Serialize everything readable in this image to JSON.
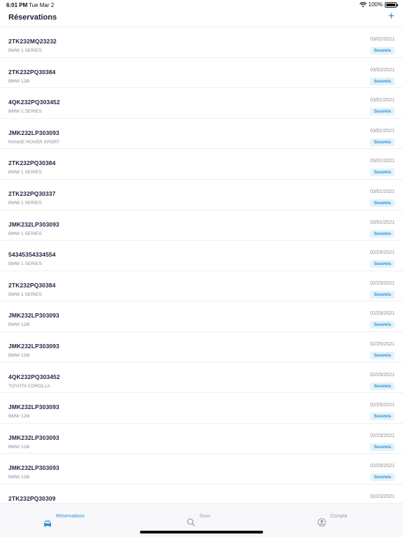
{
  "status_bar": {
    "time": "6:01 PM",
    "date": "Tue Mar 2",
    "battery": "100%",
    "battery_level": 1.0
  },
  "nav": {
    "title": "Réservations",
    "add_label": "+"
  },
  "reservations": [
    {
      "plate": "2TK232MQ23232",
      "model": "BMW 1 SERIES",
      "date": "03/02/2021",
      "status": "Soumis"
    },
    {
      "plate": "2TK232PQ30384",
      "model": "BMW 128i",
      "date": "03/02/2021",
      "status": "Soumis"
    },
    {
      "plate": "4QK232PQ303452",
      "model": "BMW 1 SERIES",
      "date": "03/01/2021",
      "status": "Soumis"
    },
    {
      "plate": "JMK232LP303093",
      "model": "RANGE ROVER SPORT",
      "date": "03/01/2021",
      "status": "Soumis"
    },
    {
      "plate": "2TK232PQ30384",
      "model": "BMW 1 SERIES",
      "date": "03/01/2021",
      "status": "Soumis"
    },
    {
      "plate": "2TK232PQ30337",
      "model": "BMW 1 SERIES",
      "date": "03/01/2021",
      "status": "Soumis"
    },
    {
      "plate": "JMK232LP303093",
      "model": "BMW 1 SERIES",
      "date": "03/01/2021",
      "status": "Soumis"
    },
    {
      "plate": "54345354334554",
      "model": "BMW 1 SERIES",
      "date": "02/26/2021",
      "status": "Soumis"
    },
    {
      "plate": "2TK232PQ30384",
      "model": "BMW 1 SERIES",
      "date": "02/25/2021",
      "status": "Soumis"
    },
    {
      "plate": "JMK232LP303093",
      "model": "BMW 128i",
      "date": "02/25/2021",
      "status": "Soumis"
    },
    {
      "plate": "JMK232LP303093",
      "model": "BMW 128i",
      "date": "02/25/2021",
      "status": "Soumis"
    },
    {
      "plate": "4QK232PQ303452",
      "model": "TOYOTA COROLLA",
      "date": "02/25/2021",
      "status": "Soumis"
    },
    {
      "plate": "JMK232LP303093",
      "model": "BMW 128i",
      "date": "02/25/2021",
      "status": "Soumis"
    },
    {
      "plate": "JMK232LP303093",
      "model": "BMW 128i",
      "date": "02/25/2021",
      "status": "Soumis"
    },
    {
      "plate": "JMK232LP303093",
      "model": "BMW 128i",
      "date": "02/25/2021",
      "status": "Soumis"
    },
    {
      "plate": "2TK232PQ30309",
      "model": "",
      "date": "02/23/2021",
      "status": ""
    }
  ],
  "tabs": [
    {
      "label": "Réservations",
      "icon": "car-icon",
      "active": true
    },
    {
      "label": "Suivi",
      "icon": "search-icon",
      "active": false
    },
    {
      "label": "Compte",
      "icon": "account-icon",
      "active": false
    }
  ],
  "colors": {
    "accent": "#2c8fd6",
    "badge_bg": "#e3f3fb",
    "text_primary": "#1f2343",
    "text_secondary": "#8c8c96"
  }
}
